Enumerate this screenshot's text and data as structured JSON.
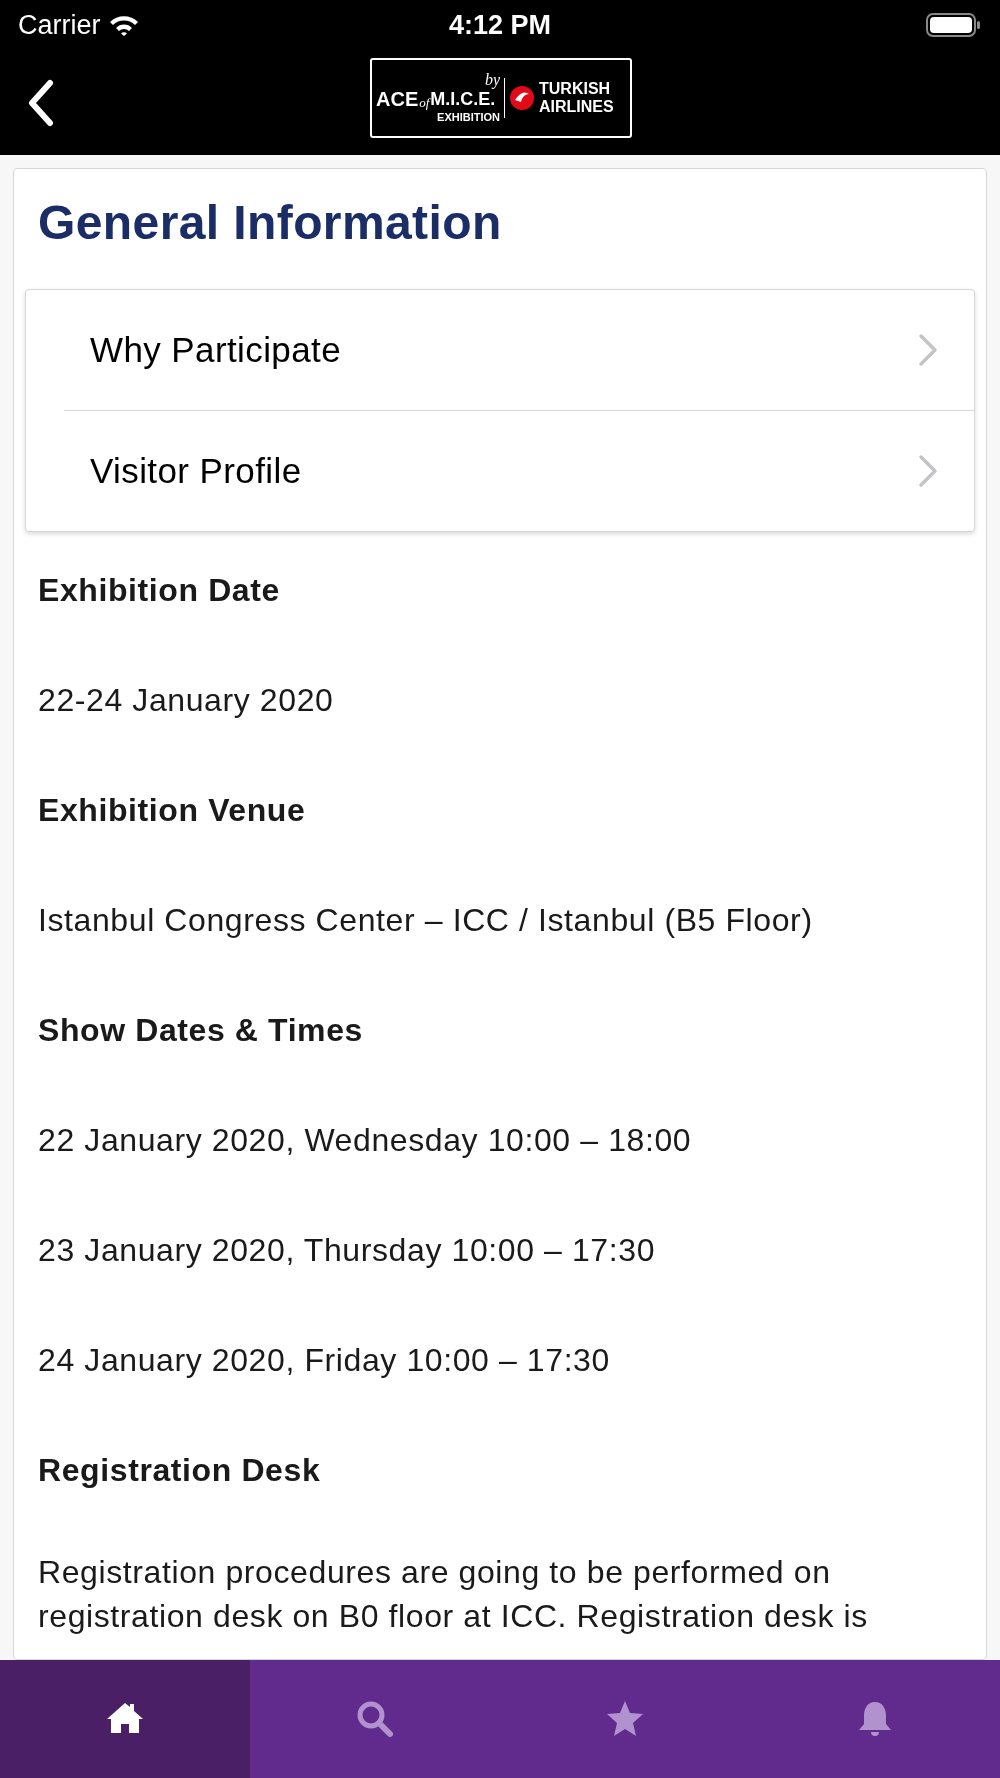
{
  "status_bar": {
    "carrier": "Carrier",
    "time": "4:12 PM"
  },
  "header": {
    "logo": {
      "brand": "ACE",
      "of": "of",
      "mice": "M.I.C.E.",
      "exhibition": "EXHIBITION",
      "by": "by",
      "partner_line1": "TURKISH",
      "partner_line2": "AIRLINES"
    }
  },
  "page": {
    "title": "General Information",
    "menu": [
      {
        "label": "Why Participate"
      },
      {
        "label": "Visitor Profile"
      }
    ],
    "sections": [
      {
        "kind": "heading",
        "text": "Exhibition Date"
      },
      {
        "kind": "text",
        "text": "22-24 January 2020"
      },
      {
        "kind": "heading",
        "text": "Exhibition Venue"
      },
      {
        "kind": "text",
        "text": "Istanbul Congress Center – ICC / Istanbul (B5 Floor)"
      },
      {
        "kind": "heading",
        "text": "Show Dates & Times"
      },
      {
        "kind": "text",
        "text": "22 January 2020, Wednesday 10:00 – 18:00"
      },
      {
        "kind": "text",
        "text": "23 January 2020, Thursday 10:00 – 17:30"
      },
      {
        "kind": "text",
        "text": "24 January 2020, Friday 10:00 – 17:30"
      },
      {
        "kind": "heading",
        "text": "Registration Desk"
      },
      {
        "kind": "paragraph",
        "text": "Registration procedures are going to be performed on registration desk on B0 floor at ICC. Registration desk is"
      }
    ]
  },
  "tab_bar": [
    {
      "selected": true
    },
    {
      "selected": false
    },
    {
      "selected": false
    },
    {
      "selected": false
    }
  ]
}
